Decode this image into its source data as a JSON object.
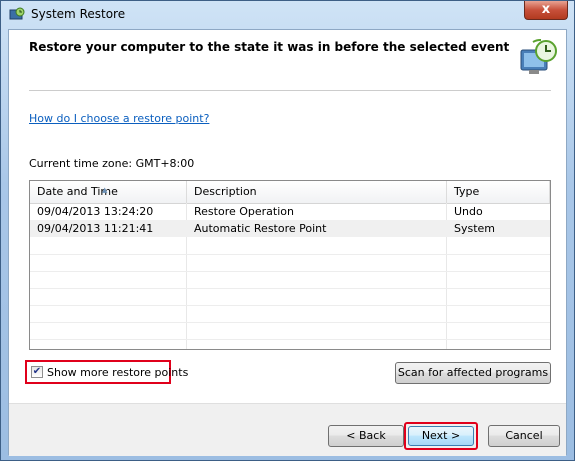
{
  "window": {
    "title": "System Restore",
    "close_glyph": "x",
    "icon": "system-restore-icon"
  },
  "header": {
    "heading": "Restore your computer to the state it was in before the selected event",
    "icon": "restore-clock-icon"
  },
  "help_link": "How do I choose a restore point?",
  "timezone_label": "Current time zone: GMT+8:00",
  "table": {
    "columns": [
      "Date and Time",
      "Description",
      "Type"
    ],
    "rows": [
      {
        "date": "09/04/2013 13:24:20",
        "description": "Restore Operation",
        "type": "Undo"
      },
      {
        "date": "09/04/2013 11:21:41",
        "description": "Automatic Restore Point",
        "type": "System"
      }
    ]
  },
  "show_more": {
    "label": "Show more restore points",
    "checked": true
  },
  "buttons": {
    "scan": "Scan for affected programs",
    "back": "< Back",
    "next": "Next >",
    "cancel": "Cancel"
  },
  "colors": {
    "highlight_border": "#e0001b",
    "link": "#0b5fbf"
  }
}
